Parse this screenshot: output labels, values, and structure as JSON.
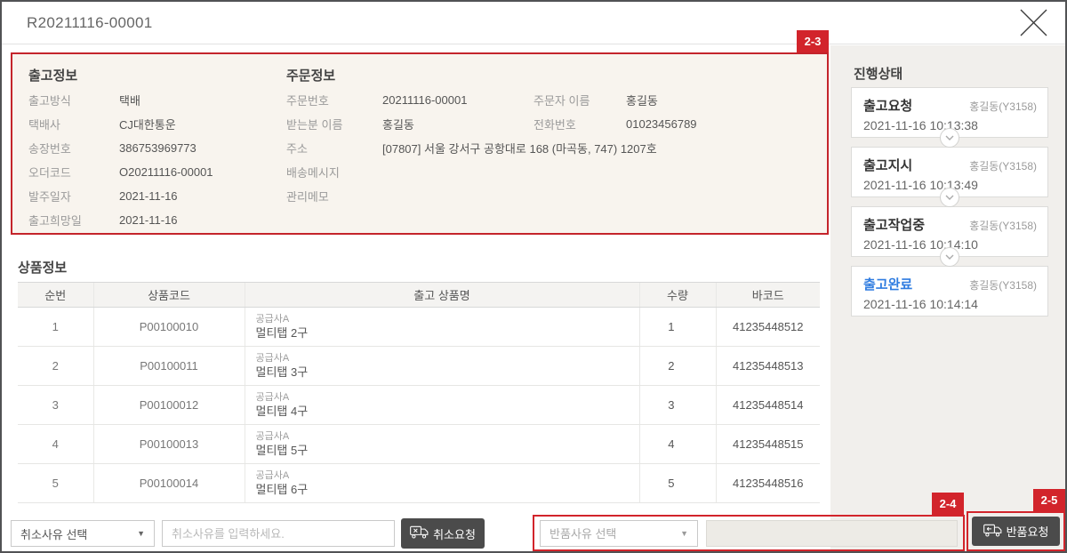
{
  "window": {
    "title": "R20211116-00001"
  },
  "annotations": {
    "info_box": "2-3",
    "return_form": "2-4",
    "return_button": "2-5",
    "accent_red": "#d2242b"
  },
  "shipping_info": {
    "title": "출고정보",
    "rows": [
      {
        "label": "출고방식",
        "value": "택배"
      },
      {
        "label": "택배사",
        "value": "CJ대한통운"
      },
      {
        "label": "송장번호",
        "value": "386753969773"
      },
      {
        "label": "오더코드",
        "value": "O20211116-00001"
      },
      {
        "label": "발주일자",
        "value": "2021-11-16"
      },
      {
        "label": "출고희망일",
        "value": "2021-11-16"
      }
    ]
  },
  "order_info": {
    "title": "주문정보",
    "rows": [
      {
        "label": "주문번호",
        "value": "20211116-00001",
        "label2": "주문자 이름",
        "value2": "홍길동"
      },
      {
        "label": "받는분 이름",
        "value": "홍길동",
        "label2": "전화번호",
        "value2": "01023456789"
      },
      {
        "label": "주소",
        "value": "[07807] 서울 강서구 공항대로 168 (마곡동, 747) 1207호"
      },
      {
        "label": "배송메시지",
        "value": ""
      },
      {
        "label": "관리메모",
        "value": ""
      }
    ]
  },
  "products": {
    "title": "상품정보",
    "columns": {
      "no": "순번",
      "code": "상품코드",
      "name": "출고 상품명",
      "qty": "수량",
      "barcode": "바코드"
    },
    "rows": [
      {
        "no": "1",
        "code": "P00100010",
        "supplier": "공급사A",
        "name": "멀티탭 2구",
        "qty": "1",
        "barcode": "41235448512"
      },
      {
        "no": "2",
        "code": "P00100011",
        "supplier": "공급사A",
        "name": "멀티탭 3구",
        "qty": "2",
        "barcode": "41235448513"
      },
      {
        "no": "3",
        "code": "P00100012",
        "supplier": "공급사A",
        "name": "멀티탭 4구",
        "qty": "3",
        "barcode": "41235448514"
      },
      {
        "no": "4",
        "code": "P00100013",
        "supplier": "공급사A",
        "name": "멀티탭 5구",
        "qty": "4",
        "barcode": "41235448515"
      },
      {
        "no": "5",
        "code": "P00100014",
        "supplier": "공급사A",
        "name": "멀티탭 6구",
        "qty": "5",
        "barcode": "41235448516"
      }
    ]
  },
  "progress": {
    "title": "진행상태",
    "steps": [
      {
        "status": "출고요청",
        "user": "홍길동(Y3158)",
        "time": "2021-11-16 10:13:38"
      },
      {
        "status": "출고지시",
        "user": "홍길동(Y3158)",
        "time": "2021-11-16 10:13:49"
      },
      {
        "status": "출고작업중",
        "user": "홍길동(Y3158)",
        "time": "2021-11-16 10:14:10"
      },
      {
        "status": "출고완료",
        "user": "홍길동(Y3158)",
        "time": "2021-11-16 10:14:14",
        "highlight_color": "#2f7ce0"
      }
    ]
  },
  "cancel_form": {
    "reason_select": "취소사유 선택",
    "reason_placeholder": "취소사유를 입력하세요.",
    "button": "취소요청"
  },
  "return_form": {
    "reason_select": "반품사유 선택",
    "reason_value": "",
    "button": "반품요청"
  }
}
